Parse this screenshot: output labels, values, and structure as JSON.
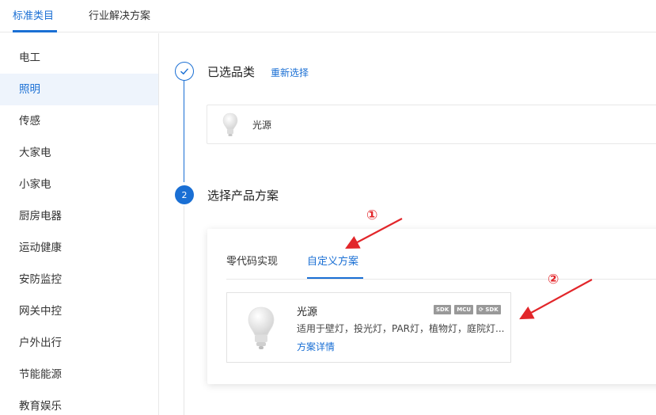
{
  "top_tabs": [
    {
      "label": "标准类目",
      "active": true
    },
    {
      "label": "行业解决方案",
      "active": false
    }
  ],
  "sidebar": {
    "items": [
      {
        "label": "电工"
      },
      {
        "label": "照明",
        "active": true
      },
      {
        "label": "传感"
      },
      {
        "label": "大家电"
      },
      {
        "label": "小家电"
      },
      {
        "label": "厨房电器"
      },
      {
        "label": "运动健康"
      },
      {
        "label": "安防监控"
      },
      {
        "label": "网关中控"
      },
      {
        "label": "户外出行"
      },
      {
        "label": "节能能源"
      },
      {
        "label": "教育娱乐"
      }
    ]
  },
  "steps": [
    {
      "number": "✓",
      "title": "已选品类",
      "action": "重新选择",
      "status": "done"
    },
    {
      "number": "2",
      "title": "选择产品方案",
      "status": "current"
    }
  ],
  "selected_category": {
    "label": "光源",
    "icon": "bulb-icon"
  },
  "scheme_tabs": [
    {
      "label": "零代码实现",
      "active": false
    },
    {
      "label": "自定义方案",
      "active": true
    }
  ],
  "scheme_card": {
    "name": "光源",
    "badges": [
      "SDK",
      "MCU",
      "⟳ SDK"
    ],
    "description": "适用于壁灯，投光灯，PAR灯，植物灯，庭院灯...",
    "detail_link": "方案详情",
    "icon": "bulb-icon"
  },
  "annotations": {
    "one": "①",
    "two": "②"
  },
  "colors": {
    "accent": "#1a6fd4",
    "annotation": "#e2262a",
    "active_bg": "#eef4fc"
  }
}
